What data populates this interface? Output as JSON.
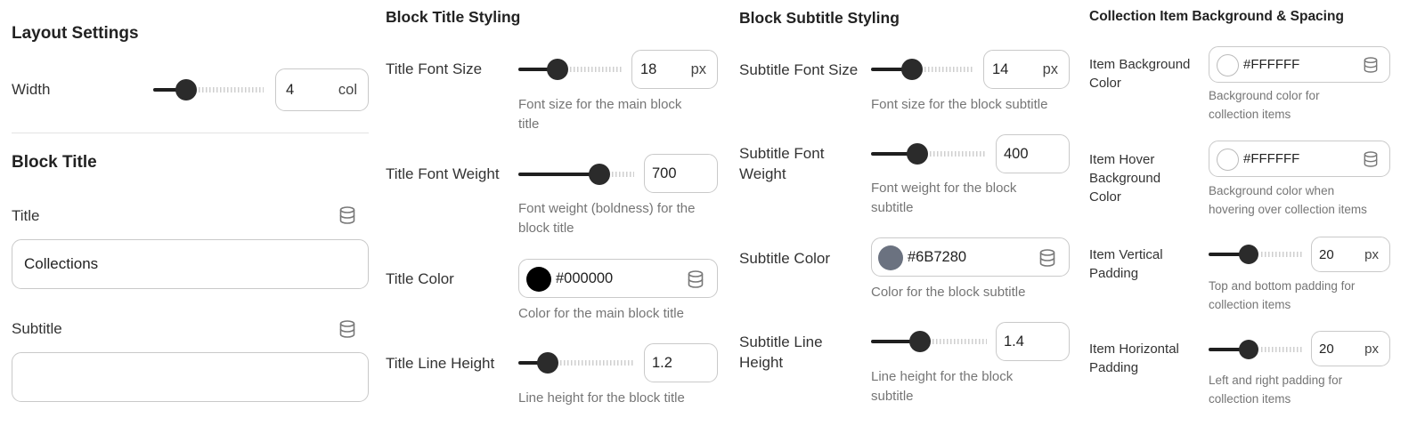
{
  "layout": {
    "heading": "Layout Settings",
    "width": {
      "label": "Width",
      "value": "4",
      "unit": "col",
      "level": 0.3
    }
  },
  "block_title": {
    "heading": "Block Title",
    "title": {
      "label": "Title",
      "value": "Collections"
    },
    "subtitle": {
      "label": "Subtitle",
      "value": ""
    }
  },
  "title_styling": {
    "heading": "Block Title Styling",
    "font_size": {
      "label": "Title Font Size",
      "value": "18",
      "unit": "px",
      "help": [
        "Font size for the main block",
        "title"
      ],
      "level": 0.38
    },
    "font_weight": {
      "label": "Title Font Weight",
      "value": "700",
      "help": [
        "Font weight (boldness) for the",
        "block title"
      ],
      "level": 0.7
    },
    "color": {
      "label": "Title Color",
      "value": "#000000",
      "swatch": "#000000",
      "help": [
        "Color for the main block title"
      ]
    },
    "line_height": {
      "label": "Title Line Height",
      "value": "1.2",
      "help": [
        "Line height for the block title"
      ],
      "level": 0.25
    }
  },
  "subtitle_styling": {
    "heading": "Block Subtitle Styling",
    "font_size": {
      "label": "Subtitle Font Size",
      "value": "14",
      "unit": "px",
      "help": [
        "Font size for the block subtitle"
      ],
      "level": 0.4
    },
    "font_weight": {
      "label": [
        "Subtitle Font",
        "Weight"
      ],
      "value": "400",
      "help": [
        "Font weight for the block",
        "subtitle"
      ],
      "level": 0.4
    },
    "color": {
      "label": "Subtitle Color",
      "value": "#6B7280",
      "swatch": "#6B7280",
      "help": [
        "Color for the block subtitle"
      ]
    },
    "line_height": {
      "label": [
        "Subtitle Line",
        "Height"
      ],
      "value": "1.4",
      "help": [
        "Line height for the block",
        "subtitle"
      ],
      "level": 0.42
    }
  },
  "collection_item": {
    "heading": "Collection Item Background & Spacing",
    "bg_color": {
      "label": [
        "Item Background",
        "Color"
      ],
      "value": "#FFFFFF",
      "swatch": "#FFFFFF",
      "help": [
        "Background color for",
        "collection items"
      ]
    },
    "hover_color": {
      "label": [
        "Item Hover",
        "Background",
        "Color"
      ],
      "value": "#FFFFFF",
      "swatch": "#FFFFFF",
      "help": [
        "Background color when",
        "hovering over collection items"
      ]
    },
    "v_padding": {
      "label": [
        "Item Vertical",
        "Padding"
      ],
      "value": "20",
      "unit": "px",
      "help": [
        "Top and bottom padding for",
        "collection items"
      ],
      "level": 0.42
    },
    "h_padding": {
      "label": [
        "Item Horizontal",
        "Padding"
      ],
      "value": "20",
      "unit": "px",
      "help": [
        "Left and right padding for",
        "collection items"
      ],
      "level": 0.42
    }
  },
  "icons": {
    "dynamic_data": "database-icon"
  },
  "colors": {
    "accent": "#1f1f1f",
    "border": "#c9c9c9",
    "help_text": "#757575"
  }
}
